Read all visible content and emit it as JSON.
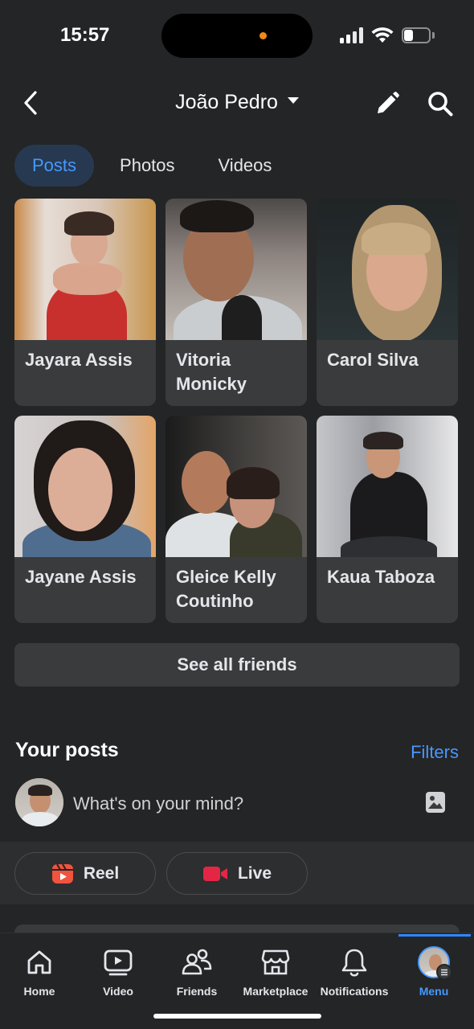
{
  "status_bar": {
    "time": "15:57",
    "battery_level": 0.35
  },
  "header": {
    "title": "João Pedro"
  },
  "tabs": [
    {
      "label": "Posts",
      "active": true
    },
    {
      "label": "Photos",
      "active": false
    },
    {
      "label": "Videos",
      "active": false
    }
  ],
  "friends": [
    {
      "name": "Jayara Assis"
    },
    {
      "name": "Vitoria Monicky"
    },
    {
      "name": "Carol Silva"
    },
    {
      "name": "Jayane Assis"
    },
    {
      "name": "Gleice Kelly Coutinho"
    },
    {
      "name": "Kaua Taboza"
    }
  ],
  "see_all_label": "See all friends",
  "your_posts": {
    "title": "Your posts",
    "filters_label": "Filters",
    "composer_placeholder": "What's on your mind?"
  },
  "quick_actions": {
    "reel_label": "Reel",
    "live_label": "Live"
  },
  "bottom_nav": {
    "items": [
      {
        "label": "Home",
        "icon": "home-icon"
      },
      {
        "label": "Video",
        "icon": "video-icon"
      },
      {
        "label": "Friends",
        "icon": "friends-icon"
      },
      {
        "label": "Marketplace",
        "icon": "marketplace-icon"
      },
      {
        "label": "Notifications",
        "icon": "bell-icon"
      },
      {
        "label": "Menu",
        "icon": "menu-avatar",
        "active": true
      }
    ]
  },
  "colors": {
    "accent": "#4599ff",
    "background": "#242526",
    "card": "#3a3b3c"
  }
}
